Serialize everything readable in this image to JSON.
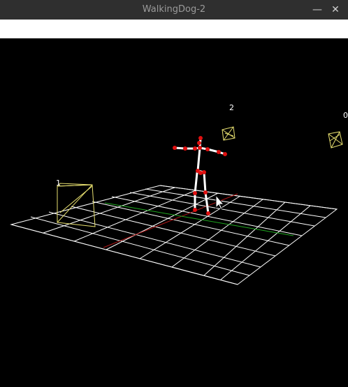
{
  "window": {
    "title": "WalkingDog-2",
    "minimize_glyph": "—",
    "close_glyph": "✕"
  },
  "viewport": {
    "background": "#000000",
    "grid_color": "#ffffff",
    "x_axis_color": "#b01818",
    "z_axis_color": "#1fa81f",
    "camera_color": "#e8e070",
    "joint_color": "#e01010",
    "bone_color": "#ffffff",
    "cameras": [
      {
        "label": "1"
      },
      {
        "label": "2"
      },
      {
        "label": "0"
      }
    ]
  }
}
